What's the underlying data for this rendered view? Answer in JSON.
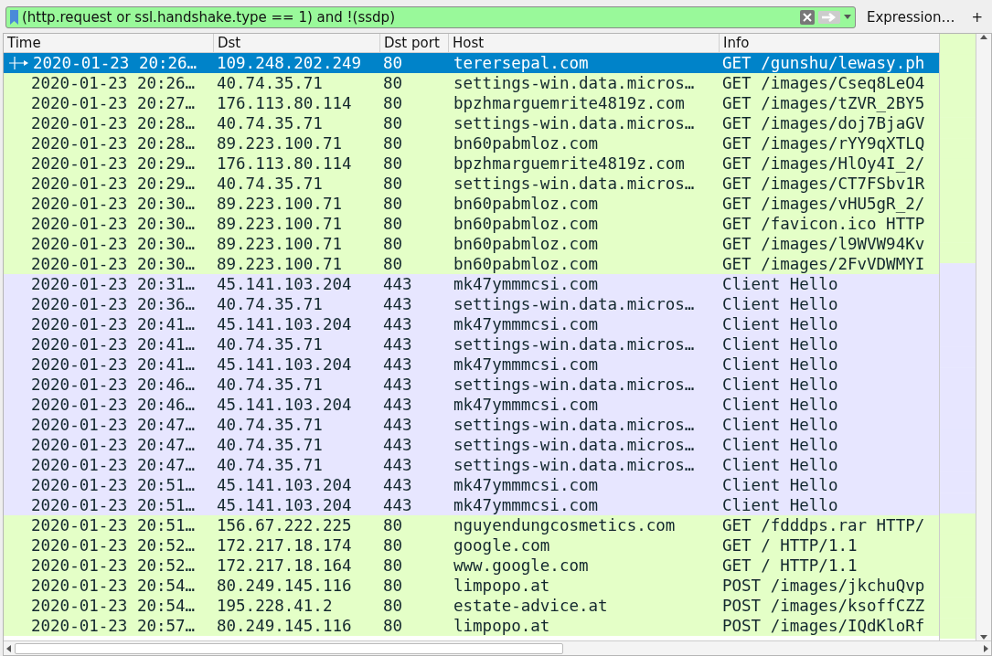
{
  "filter_bar": {
    "value": "(http.request or ssl.handshake.type == 1) and !(ssdp)",
    "expression_button": "Expression…",
    "add_button": "+"
  },
  "table": {
    "columns": [
      "Time",
      "Dst",
      "Dst port",
      "Host",
      "Info"
    ],
    "rows": [
      {
        "selected": true,
        "color": "#e4ffc7",
        "cells": [
          "2020-01-23 20:26…",
          "109.248.202.249",
          "80",
          "terersepal.com",
          "GET /gunshu/lewasy.ph"
        ]
      },
      {
        "selected": false,
        "color": "#e4ffc7",
        "cells": [
          "2020-01-23 20:26…",
          "40.74.35.71",
          "80",
          "settings-win.data.micros…",
          "GET /images/Cseq8LeO4"
        ]
      },
      {
        "selected": false,
        "color": "#e4ffc7",
        "cells": [
          "2020-01-23 20:27…",
          "176.113.80.114",
          "80",
          "bpzhmarguemrite4819z.com",
          "GET /images/tZVR_2BY5"
        ]
      },
      {
        "selected": false,
        "color": "#e4ffc7",
        "cells": [
          "2020-01-23 20:28…",
          "40.74.35.71",
          "80",
          "settings-win.data.micros…",
          "GET /images/doj7BjaGV"
        ]
      },
      {
        "selected": false,
        "color": "#e4ffc7",
        "cells": [
          "2020-01-23 20:28…",
          "89.223.100.71",
          "80",
          "bn60pabmloz.com",
          "GET /images/rYY9qXTLQ"
        ]
      },
      {
        "selected": false,
        "color": "#e4ffc7",
        "cells": [
          "2020-01-23 20:29…",
          "176.113.80.114",
          "80",
          "bpzhmarguemrite4819z.com",
          "GET /images/HlOy4I_2/"
        ]
      },
      {
        "selected": false,
        "color": "#e4ffc7",
        "cells": [
          "2020-01-23 20:29…",
          "40.74.35.71",
          "80",
          "settings-win.data.micros…",
          "GET /images/CT7FSbv1R"
        ]
      },
      {
        "selected": false,
        "color": "#e4ffc7",
        "cells": [
          "2020-01-23 20:30…",
          "89.223.100.71",
          "80",
          "bn60pabmloz.com",
          "GET /images/vHU5gR_2/"
        ]
      },
      {
        "selected": false,
        "color": "#e4ffc7",
        "cells": [
          "2020-01-23 20:30…",
          "89.223.100.71",
          "80",
          "bn60pabmloz.com",
          "GET /favicon.ico HTTP"
        ]
      },
      {
        "selected": false,
        "color": "#e4ffc7",
        "cells": [
          "2020-01-23 20:30…",
          "89.223.100.71",
          "80",
          "bn60pabmloz.com",
          "GET /images/l9WVW94Kv"
        ]
      },
      {
        "selected": false,
        "color": "#e4ffc7",
        "cells": [
          "2020-01-23 20:30…",
          "89.223.100.71",
          "80",
          "bn60pabmloz.com",
          "GET /images/2FvVDWMYI"
        ]
      },
      {
        "selected": false,
        "color": "#e7e6ff",
        "cells": [
          "2020-01-23 20:31…",
          "45.141.103.204",
          "443",
          "mk47ymmmcsi.com",
          "Client Hello"
        ]
      },
      {
        "selected": false,
        "color": "#e7e6ff",
        "cells": [
          "2020-01-23 20:36…",
          "40.74.35.71",
          "443",
          "settings-win.data.micros…",
          "Client Hello"
        ]
      },
      {
        "selected": false,
        "color": "#e7e6ff",
        "cells": [
          "2020-01-23 20:41…",
          "45.141.103.204",
          "443",
          "mk47ymmmcsi.com",
          "Client Hello"
        ]
      },
      {
        "selected": false,
        "color": "#e7e6ff",
        "cells": [
          "2020-01-23 20:41…",
          "40.74.35.71",
          "443",
          "settings-win.data.micros…",
          "Client Hello"
        ]
      },
      {
        "selected": false,
        "color": "#e7e6ff",
        "cells": [
          "2020-01-23 20:41…",
          "45.141.103.204",
          "443",
          "mk47ymmmcsi.com",
          "Client Hello"
        ]
      },
      {
        "selected": false,
        "color": "#e7e6ff",
        "cells": [
          "2020-01-23 20:46…",
          "40.74.35.71",
          "443",
          "settings-win.data.micros…",
          "Client Hello"
        ]
      },
      {
        "selected": false,
        "color": "#e7e6ff",
        "cells": [
          "2020-01-23 20:46…",
          "45.141.103.204",
          "443",
          "mk47ymmmcsi.com",
          "Client Hello"
        ]
      },
      {
        "selected": false,
        "color": "#e7e6ff",
        "cells": [
          "2020-01-23 20:47…",
          "40.74.35.71",
          "443",
          "settings-win.data.micros…",
          "Client Hello"
        ]
      },
      {
        "selected": false,
        "color": "#e7e6ff",
        "cells": [
          "2020-01-23 20:47…",
          "40.74.35.71",
          "443",
          "settings-win.data.micros…",
          "Client Hello"
        ]
      },
      {
        "selected": false,
        "color": "#e7e6ff",
        "cells": [
          "2020-01-23 20:47…",
          "40.74.35.71",
          "443",
          "settings-win.data.micros…",
          "Client Hello"
        ]
      },
      {
        "selected": false,
        "color": "#e7e6ff",
        "cells": [
          "2020-01-23 20:51…",
          "45.141.103.204",
          "443",
          "mk47ymmmcsi.com",
          "Client Hello"
        ]
      },
      {
        "selected": false,
        "color": "#e7e6ff",
        "cells": [
          "2020-01-23 20:51…",
          "45.141.103.204",
          "443",
          "mk47ymmmcsi.com",
          "Client Hello"
        ]
      },
      {
        "selected": false,
        "color": "#e4ffc7",
        "cells": [
          "2020-01-23 20:51…",
          "156.67.222.225",
          "80",
          "nguyendungcosmetics.com",
          "GET /fdddps.rar HTTP/"
        ]
      },
      {
        "selected": false,
        "color": "#e4ffc7",
        "cells": [
          "2020-01-23 20:52…",
          "172.217.18.174",
          "80",
          "google.com",
          "GET / HTTP/1.1"
        ]
      },
      {
        "selected": false,
        "color": "#e4ffc7",
        "cells": [
          "2020-01-23 20:52…",
          "172.217.18.164",
          "80",
          "www.google.com",
          "GET / HTTP/1.1"
        ]
      },
      {
        "selected": false,
        "color": "#e4ffc7",
        "cells": [
          "2020-01-23 20:54…",
          "80.249.145.116",
          "80",
          "limpopo.at",
          "POST /images/jkchuQvp"
        ]
      },
      {
        "selected": false,
        "color": "#e4ffc7",
        "cells": [
          "2020-01-23 20:54…",
          "195.228.41.2",
          "80",
          "estate-advice.at",
          "POST /images/ksoffCZZ"
        ]
      },
      {
        "selected": false,
        "color": "#e4ffc7",
        "cells": [
          "2020-01-23 20:57…",
          "80.249.145.116",
          "80",
          "limpopo.at",
          "POST /images/IQdKloRf"
        ]
      }
    ]
  }
}
